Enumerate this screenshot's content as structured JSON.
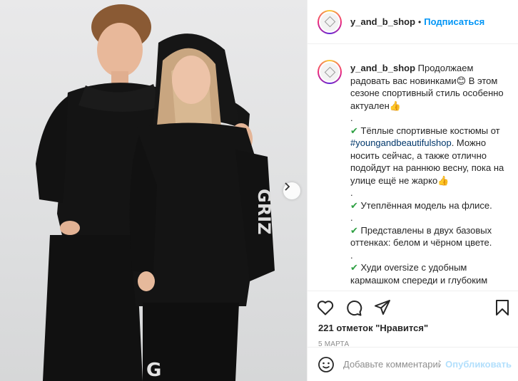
{
  "post": {
    "username": "y_and_b_shop",
    "follow_label": "Подписаться",
    "separator": "•"
  },
  "caption": {
    "username": "y_and_b_shop",
    "lines": [
      "Продолжаем радовать вас новинками😊 В этом сезоне спортивный стиль особенно актуален👍",
      ".",
      "Тёплые спортивные костюмы от",
      "#youngandbeautifulshop",
      ". Можно носить сейчас, а также отлично подойдут на раннюю весну, пока на улице ещё не жарко👍",
      ".",
      "Утеплённая модель на флисе.",
      ".",
      "Представлены в двух базовых оттенках: белом и чёрном цвете.",
      ".",
      "Худи oversize с удобным кармашком спереди и глубоким капюшоном.",
      "."
    ]
  },
  "actions": {
    "like_icon": "heart-icon",
    "comment_icon": "comment-icon",
    "share_icon": "paper-plane-icon",
    "save_icon": "bookmark-icon",
    "likes_count": "221",
    "likes_text": "отметок \"Нравится\"",
    "date": "5 МАРТА"
  },
  "comment_box": {
    "placeholder": "Добавьте комментарий...",
    "publish_label": "Опубликовать",
    "emoji_icon": "smiley-icon"
  },
  "photo": {
    "next_icon": "chevron-right-icon",
    "background_color": "#e2e3e4",
    "clothing_color": "#141414"
  }
}
